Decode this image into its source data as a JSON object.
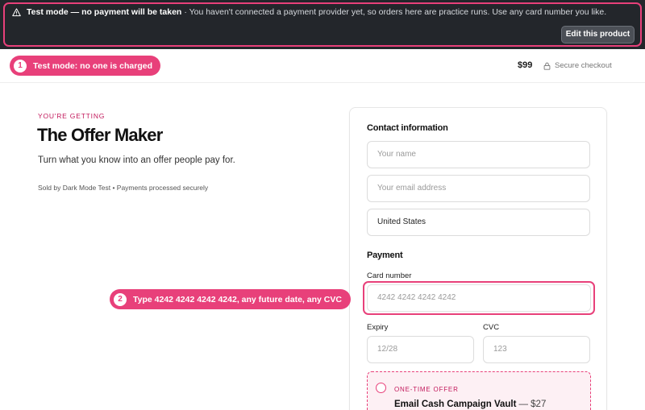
{
  "banner": {
    "icon": "warning-icon",
    "strong_text": "Test mode — no payment will be taken",
    "message": "· You haven't connected a payment provider yet, so orders here are practice runs. Use any card number you like.",
    "edit_button": "Edit this product",
    "accent_color": "#e8407a"
  },
  "header": {
    "step1": {
      "number": "1",
      "text": "Test mode: no one is charged"
    },
    "price": "$99",
    "secure_label": "Secure checkout",
    "secure_icon": "lock-icon"
  },
  "product": {
    "eyebrow": "YOU'RE GETTING",
    "title": "The Offer Maker",
    "subtitle": "Turn what you know into an offer people pay for.",
    "seller_line": "Sold by Dark Mode Test • Payments processed securely"
  },
  "contact": {
    "heading": "Contact information",
    "name_placeholder": "Your name",
    "email_placeholder": "Your email address",
    "country_value": "United States"
  },
  "payment": {
    "heading": "Payment",
    "card_label": "Card number",
    "card_placeholder": "4242 4242 4242 4242",
    "expiry_label": "Expiry",
    "expiry_placeholder": "12/28",
    "cvc_label": "CVC",
    "cvc_placeholder": "123",
    "step2": {
      "number": "2",
      "text": "Type 4242 4242 4242 4242, any future date, any CVC"
    }
  },
  "offer": {
    "tag": "ONE-TIME OFFER",
    "title": "Email Cash Campaign Vault",
    "price": "— $27"
  }
}
